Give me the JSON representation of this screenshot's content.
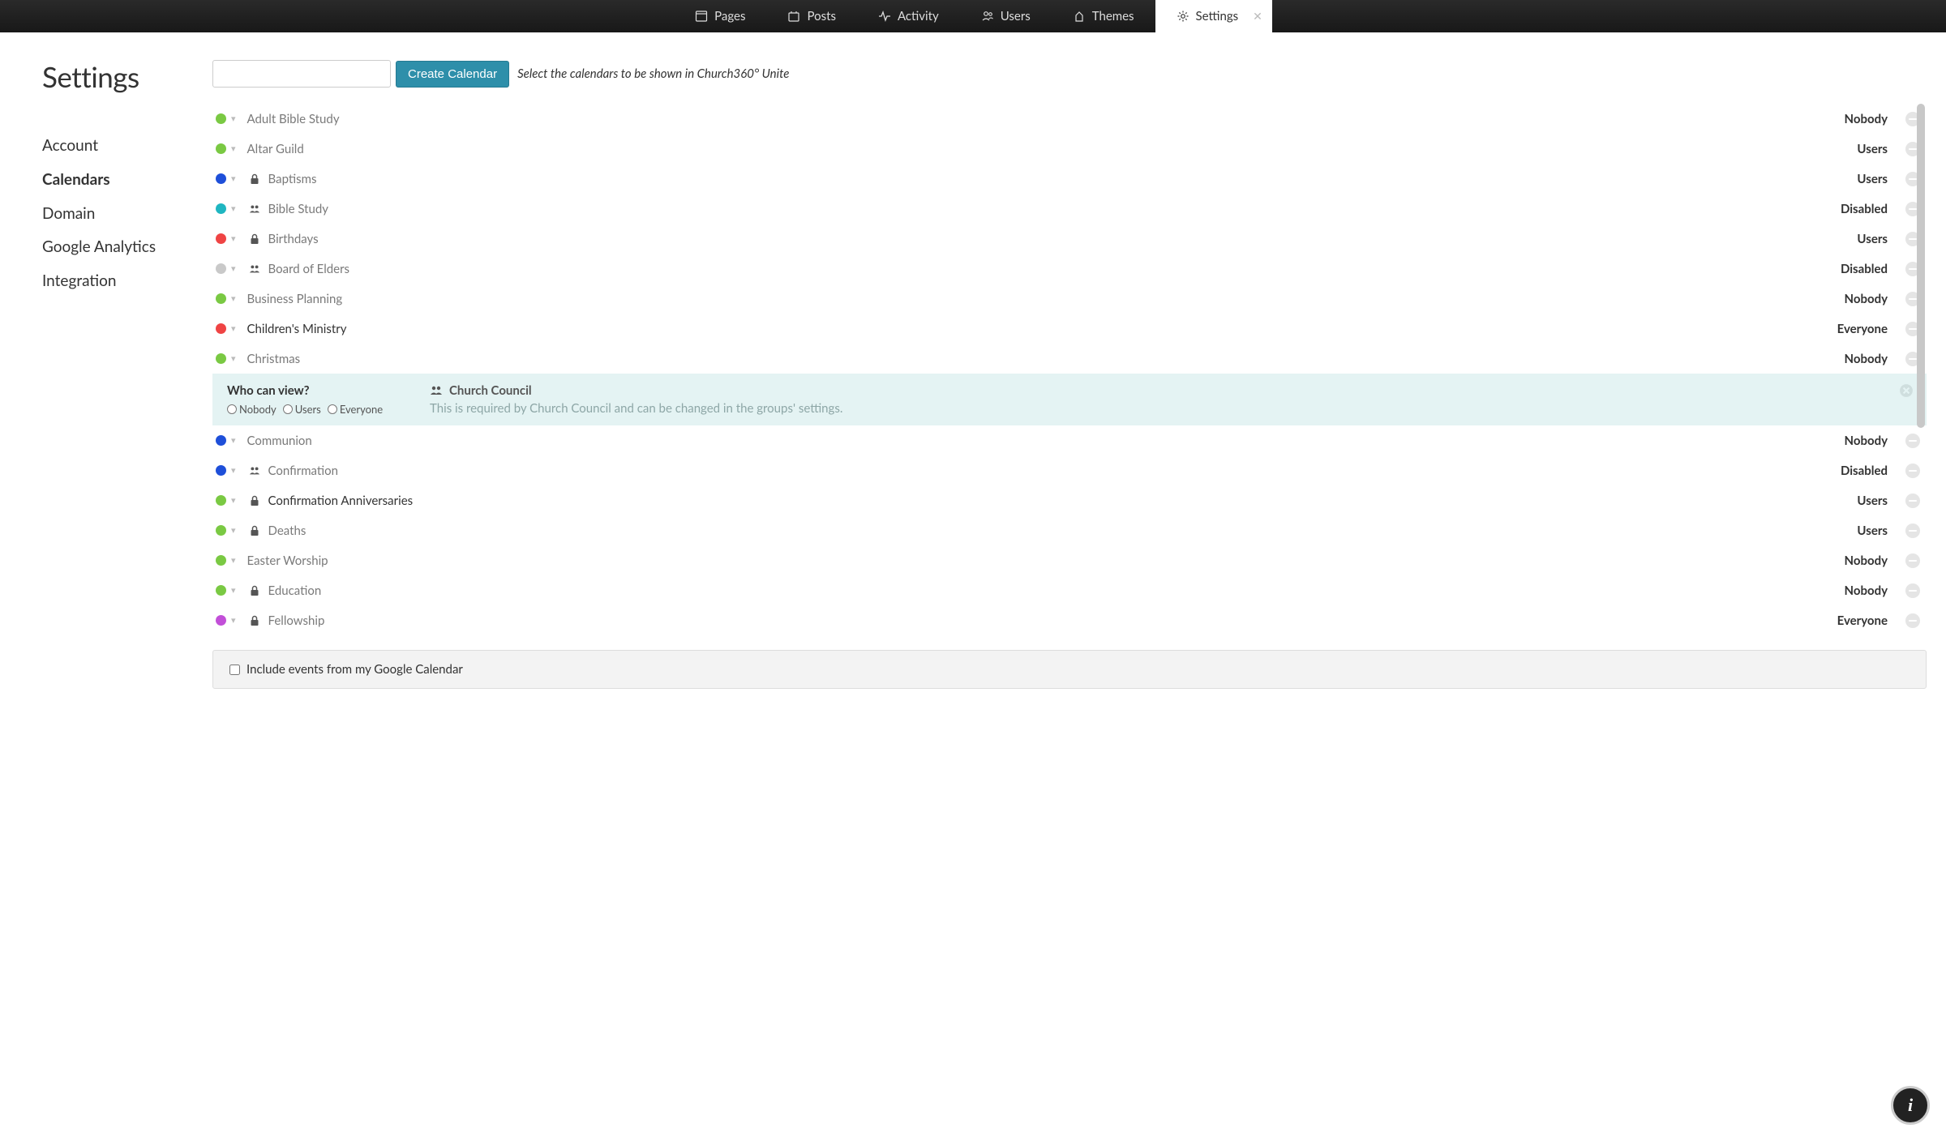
{
  "topnav": {
    "items": [
      {
        "label": "Pages"
      },
      {
        "label": "Posts"
      },
      {
        "label": "Activity"
      },
      {
        "label": "Users"
      },
      {
        "label": "Themes"
      },
      {
        "label": "Settings"
      }
    ]
  },
  "sidebar": {
    "title": "Settings",
    "items": [
      {
        "label": "Account"
      },
      {
        "label": "Calendars"
      },
      {
        "label": "Domain"
      },
      {
        "label": "Google Analytics"
      },
      {
        "label": "Integration"
      }
    ]
  },
  "toolbar": {
    "search_placeholder": "",
    "create_label": "Create Calendar",
    "hint": "Select the calendars to be shown in Church360° Unite"
  },
  "calendars": [
    {
      "name": "Adult Bible Study",
      "visibility": "Nobody",
      "dot": "c-green"
    },
    {
      "name": "Altar Guild",
      "visibility": "Users",
      "dot": "c-green"
    },
    {
      "name": "Baptisms",
      "visibility": "Users",
      "dot": "c-blue",
      "icon": "lock"
    },
    {
      "name": "Bible Study",
      "visibility": "Disabled",
      "dot": "c-teal",
      "icon": "group"
    },
    {
      "name": "Birthdays",
      "visibility": "Users",
      "dot": "c-red",
      "icon": "lock"
    },
    {
      "name": "Board of Elders",
      "visibility": "Disabled",
      "dot": "c-gray",
      "icon": "group"
    },
    {
      "name": "Business Planning",
      "visibility": "Nobody",
      "dot": "c-green"
    },
    {
      "name": "Children's Ministry",
      "visibility": "Everyone",
      "dot": "c-red",
      "dark": true
    },
    {
      "name": "Christmas",
      "visibility": "Nobody",
      "dot": "c-green"
    }
  ],
  "expanded": {
    "who_title": "Who can view?",
    "options": [
      "Nobody",
      "Users",
      "Everyone"
    ],
    "title": "Church Council",
    "note": "This is required by Church Council and can be changed in the groups' settings."
  },
  "calendars2": [
    {
      "name": "Communion",
      "visibility": "Nobody",
      "dot": "c-blue"
    },
    {
      "name": "Confirmation",
      "visibility": "Disabled",
      "dot": "c-blue",
      "icon": "group"
    },
    {
      "name": "Confirmation Anniversaries",
      "visibility": "Users",
      "dot": "c-green",
      "icon": "lock",
      "dark": true
    },
    {
      "name": "Deaths",
      "visibility": "Users",
      "dot": "c-green",
      "icon": "lock"
    },
    {
      "name": "Easter Worship",
      "visibility": "Nobody",
      "dot": "c-green"
    },
    {
      "name": "Education",
      "visibility": "Nobody",
      "dot": "c-green",
      "icon": "lock"
    },
    {
      "name": "Fellowship",
      "visibility": "Everyone",
      "dot": "c-purple",
      "icon": "lock"
    }
  ],
  "gcal": {
    "label": "Include events from my Google Calendar"
  },
  "info_fab": "i"
}
